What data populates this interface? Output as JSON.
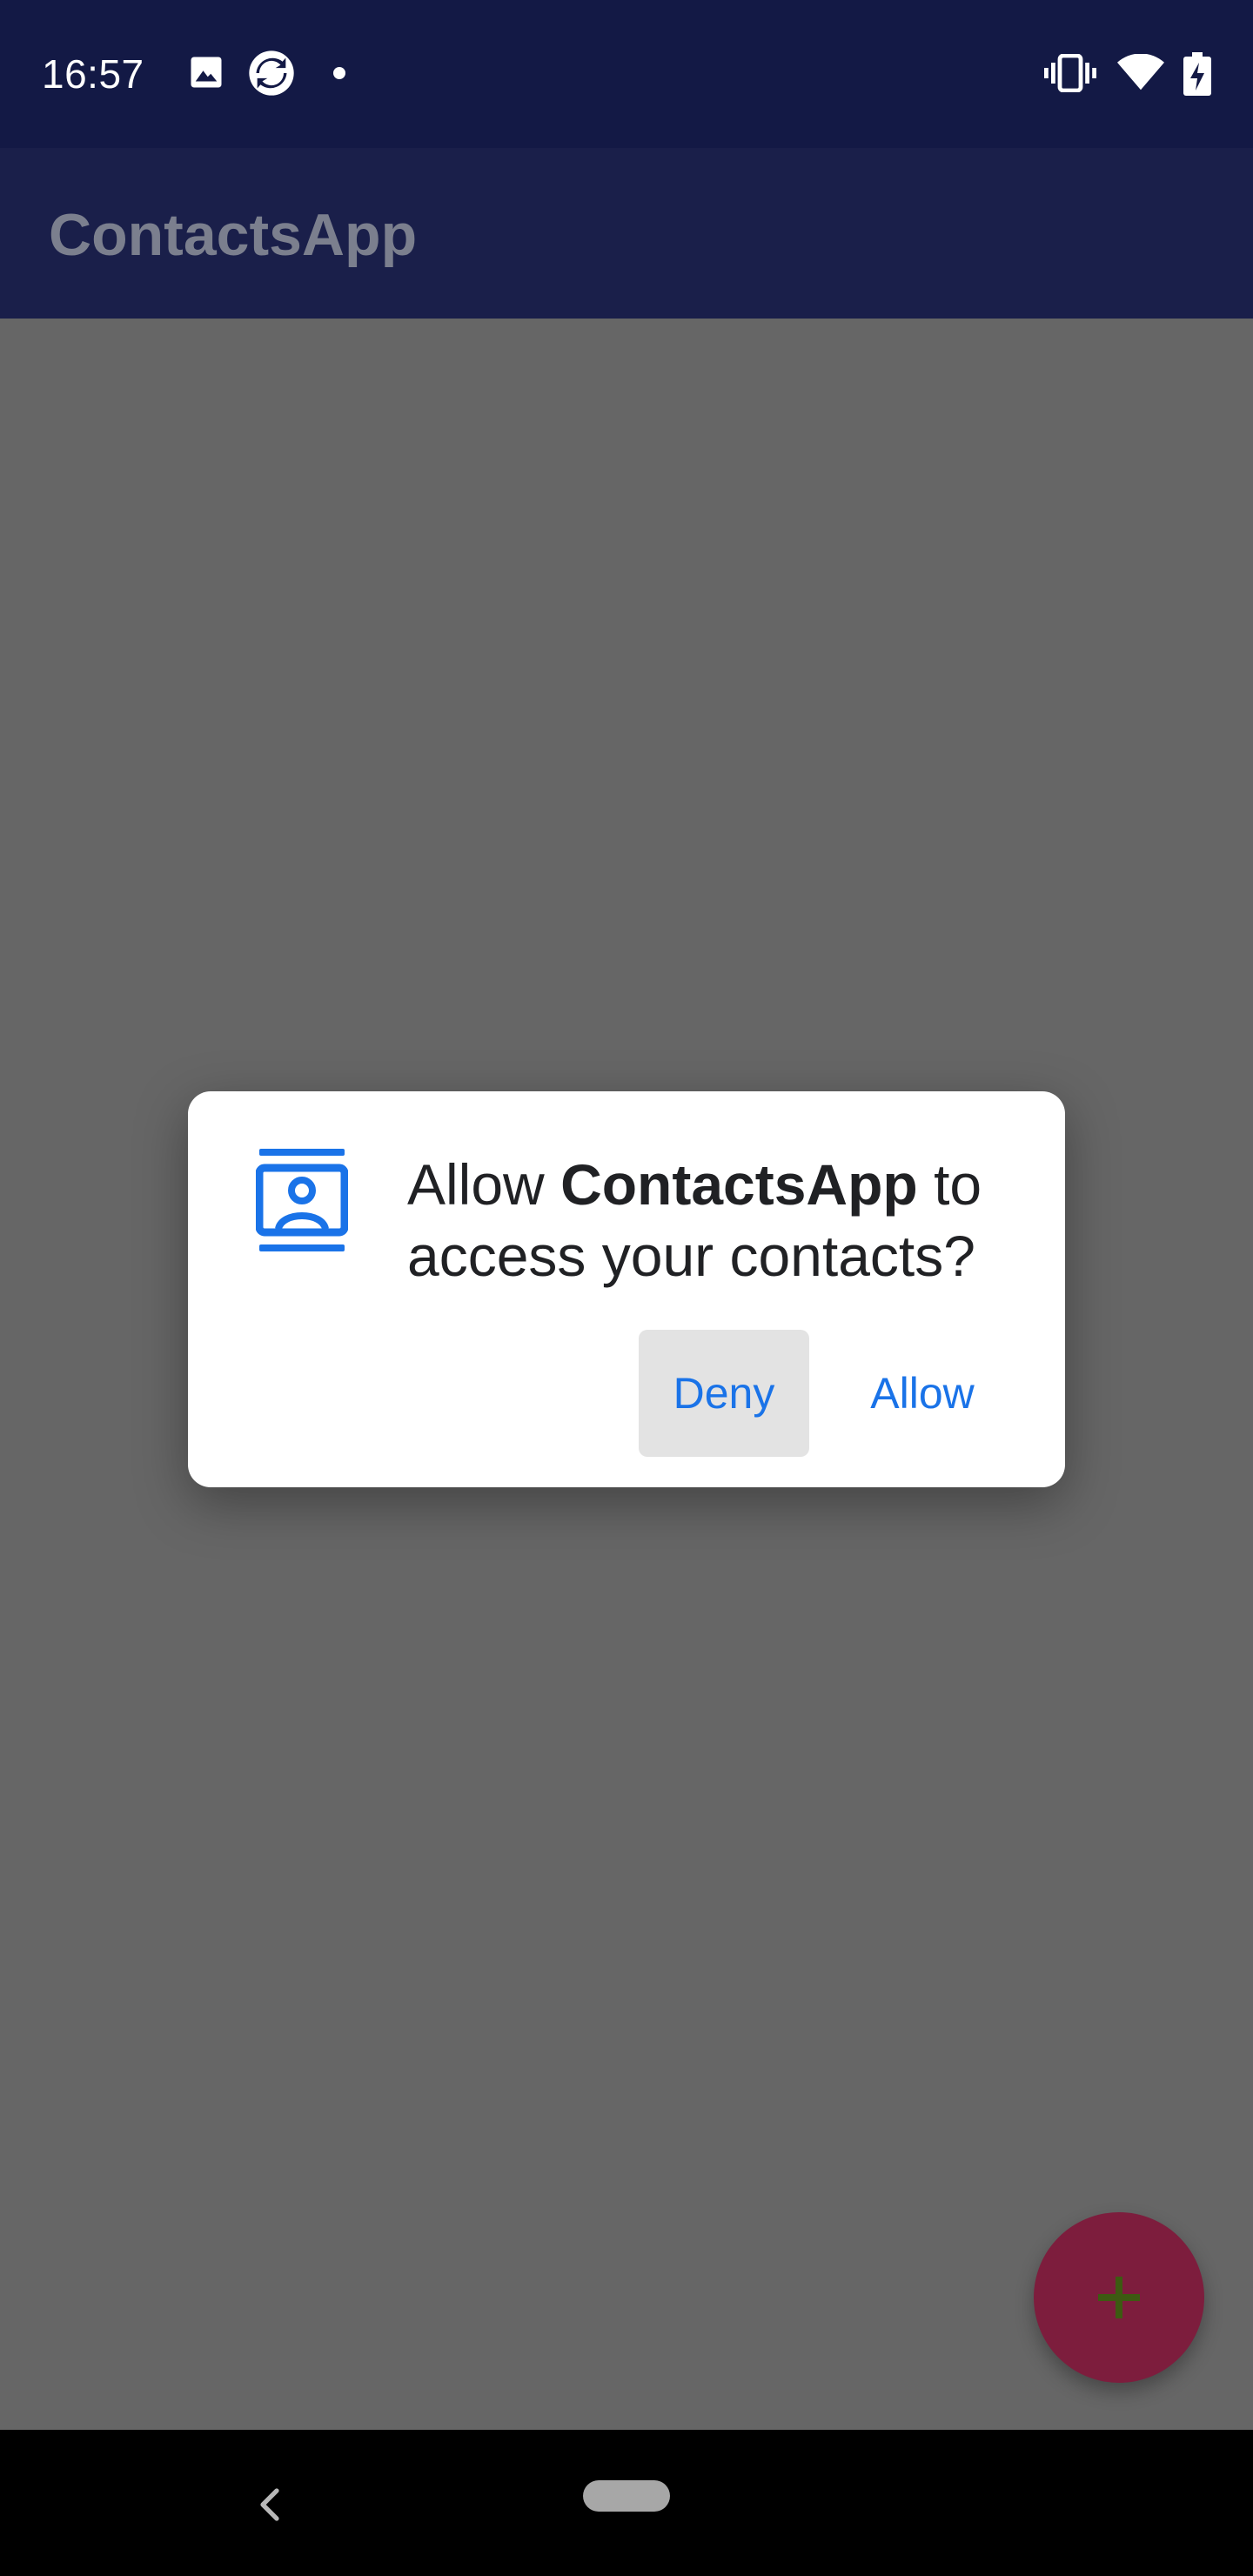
{
  "status_bar": {
    "time": "16:57",
    "left_icons": [
      "image-icon",
      "sync-icon",
      "dot-icon"
    ],
    "right_icons": [
      "vibrate-icon",
      "wifi-icon",
      "battery-charging-icon"
    ]
  },
  "app_bar": {
    "title": "ContactsApp"
  },
  "dialog": {
    "icon": "contacts-icon",
    "message_prefix": "Allow ",
    "app_name": "ContactsApp",
    "message_suffix": " to access your contacts?",
    "deny_label": "Deny",
    "allow_label": "Allow"
  },
  "fab": {
    "icon": "plus-icon"
  },
  "nav_bar": {
    "icons": [
      "back-icon",
      "home-pill"
    ]
  },
  "colors": {
    "status_bar": "#131945",
    "app_bar": "#1a1f4a",
    "scrim": "#666666",
    "accent": "#1a73e8",
    "fab": "#7d1d3d",
    "fab_icon": "#3d5a12"
  }
}
